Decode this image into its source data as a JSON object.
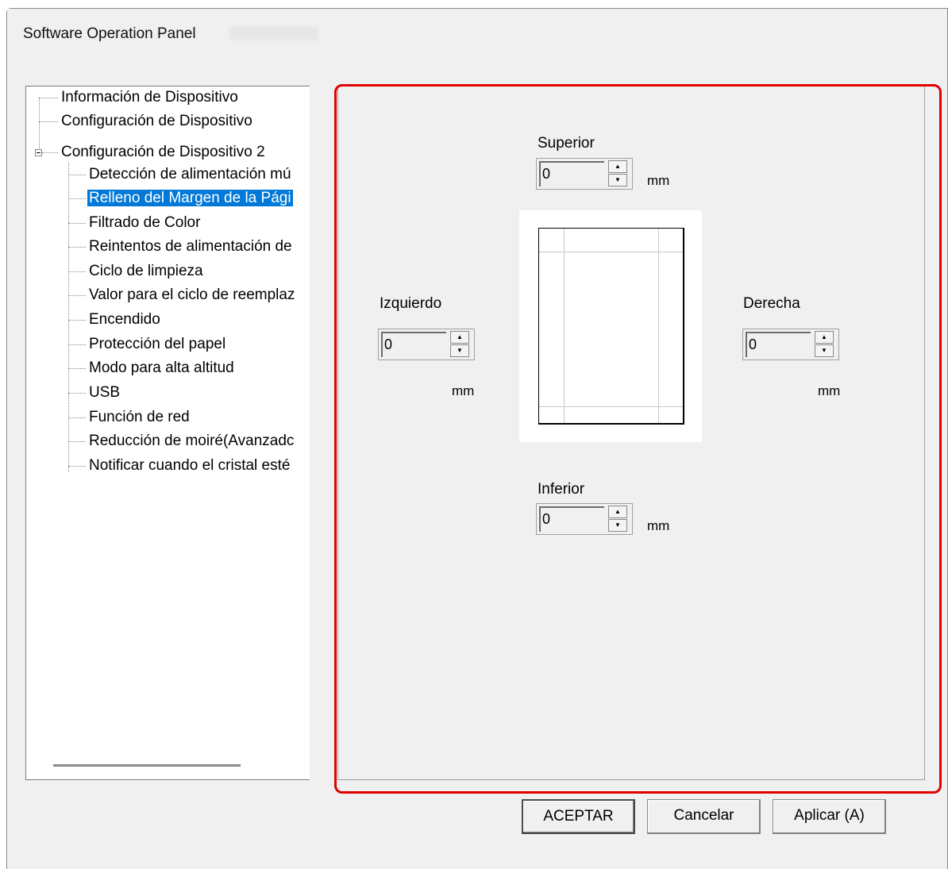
{
  "window": {
    "title": "Software Operation Panel"
  },
  "tree": {
    "items": [
      {
        "label": "Información de Dispositivo"
      },
      {
        "label": "Configuración de Dispositivo"
      },
      {
        "label": "Configuración de Dispositivo 2"
      },
      {
        "label": "Detección de alimentación mú"
      },
      {
        "label": "Relleno del Margen de la Pági"
      },
      {
        "label": "Filtrado de Color"
      },
      {
        "label": "Reintentos de alimentación de"
      },
      {
        "label": "Ciclo de limpieza"
      },
      {
        "label": "Valor para el ciclo de reemplaz"
      },
      {
        "label": "Encendido"
      },
      {
        "label": "Protección del papel"
      },
      {
        "label": "Modo para alta altitud"
      },
      {
        "label": "USB"
      },
      {
        "label": "Función de red"
      },
      {
        "label": "Reducción de moiré(Avanzadc"
      },
      {
        "label": "Notificar cuando el cristal esté"
      }
    ],
    "selected": "Relleno del Margen de la Pági"
  },
  "margins": {
    "top": {
      "label": "Superior",
      "value": "0",
      "unit": "mm"
    },
    "left": {
      "label": "Izquierdo",
      "value": "0",
      "unit": "mm"
    },
    "right": {
      "label": "Derecha",
      "value": "0",
      "unit": "mm"
    },
    "bottom": {
      "label": "Inferior",
      "value": "0",
      "unit": "mm"
    }
  },
  "buttons": {
    "ok": "ACEPTAR",
    "cancel": "Cancelar",
    "apply": "Aplicar (A)"
  },
  "spin_glyphs": {
    "up": "▲",
    "down": "▼"
  },
  "colors": {
    "selection": "#0078d7",
    "highlight_border": "#e00000",
    "window_bg": "#f0f0f0"
  }
}
